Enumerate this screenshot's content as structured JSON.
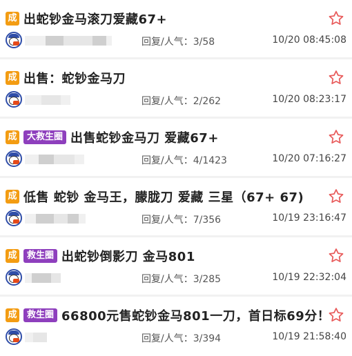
{
  "posts": [
    {
      "tag_label": "成",
      "extra_tag": "",
      "title": "出蛇钞金马滚刀爱藏67+",
      "stats": "回复/人气：3/58",
      "time": "10/20 08:45:08"
    },
    {
      "tag_label": "成",
      "extra_tag": "",
      "title": "出售：蛇钞金马刀",
      "stats": "回复/人气：2/262",
      "time": "10/20 08:23:17"
    },
    {
      "tag_label": "成",
      "extra_tag": "大救生圈",
      "title": "出售蛇钞金马刀 爱藏67+",
      "stats": "回复/人气：4/1423",
      "time": "10/20 07:16:27"
    },
    {
      "tag_label": "成",
      "extra_tag": "",
      "title": "低售 蛇钞 金马王，朦胧刀 爱藏 三星（67+ 67)",
      "stats": "回复/人气：7/356",
      "time": "10/19 23:16:47"
    },
    {
      "tag_label": "成",
      "extra_tag": "救生圈",
      "title": "出蛇钞倒影刀 金马801",
      "stats": "回复/人气：3/285",
      "time": "10/19 22:32:04"
    },
    {
      "tag_label": "成",
      "extra_tag": "救生圈",
      "title": "66800元售蛇钞金马801一刀，首日标69分！",
      "stats": "回复/人气：3/394",
      "time": "10/19 21:58:40"
    }
  ],
  "icons": {
    "favorite": "star-outline-icon",
    "avatar": "user-avatar"
  },
  "colors": {
    "tag_orange": "#f39c12",
    "tag_purple": "#8e3fbd",
    "star_red": "#e85a5a",
    "divider": "#f1f1f1"
  }
}
